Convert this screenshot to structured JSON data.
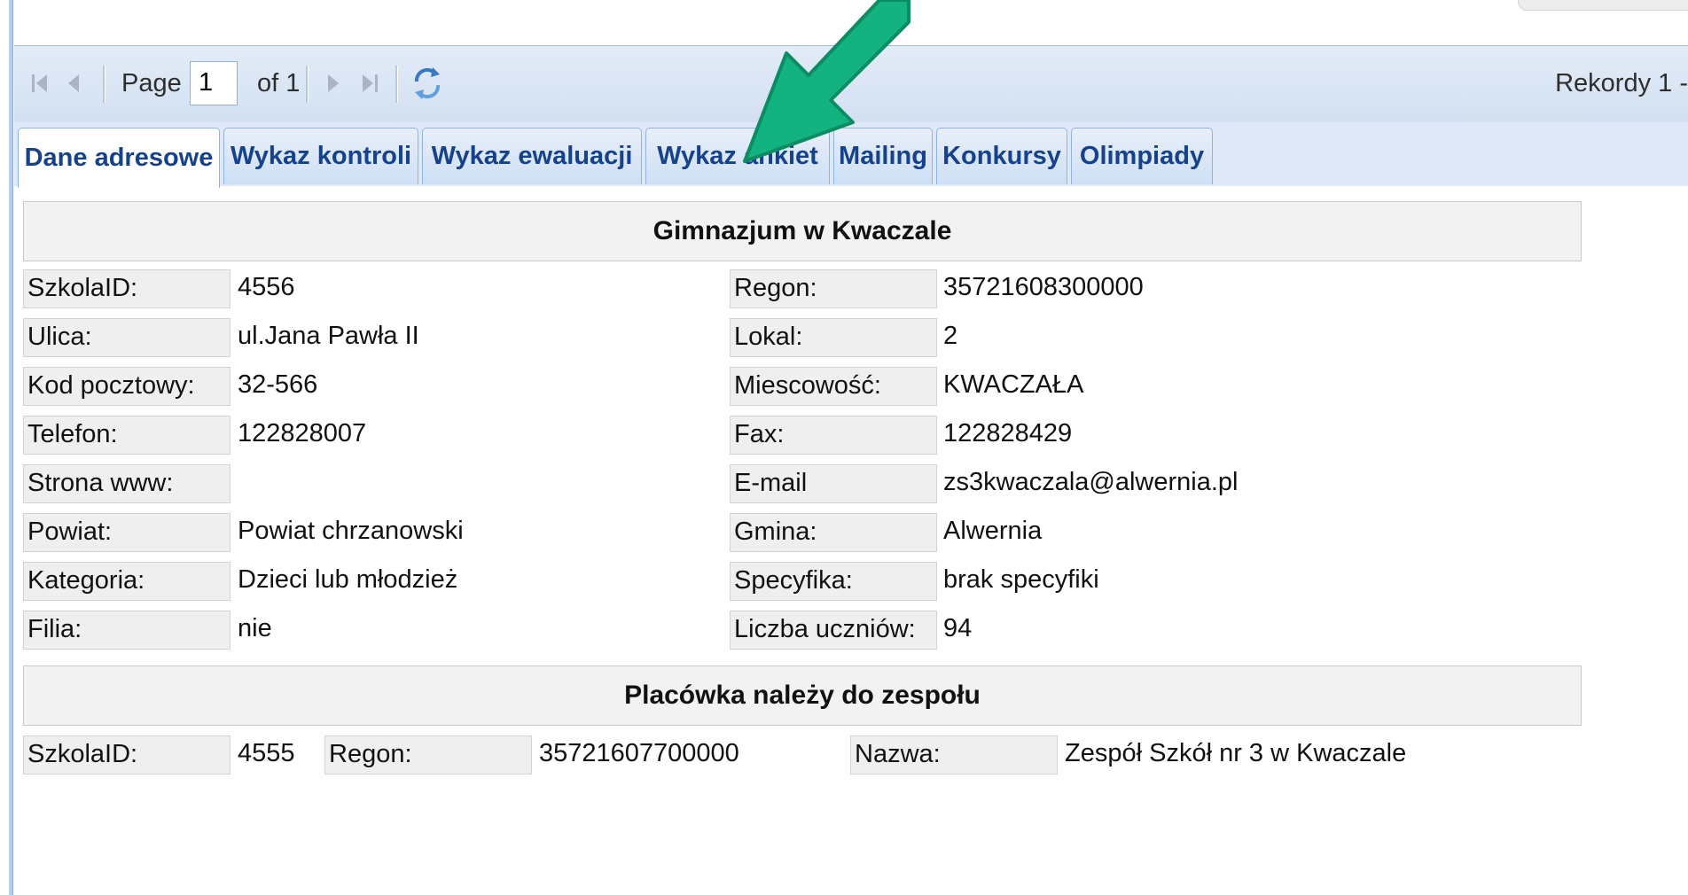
{
  "toolbar": {
    "page_label": "Page",
    "page_value": "1",
    "of_label": "of 1",
    "records_text": "Rekordy 1 -"
  },
  "tabs": [
    {
      "label": "Dane adresowe",
      "active": true
    },
    {
      "label": "Wykaz kontroli",
      "active": false
    },
    {
      "label": "Wykaz ewaluacji",
      "active": false
    },
    {
      "label": "Wykaz ankiet",
      "active": false
    },
    {
      "label": "Mailing",
      "active": false
    },
    {
      "label": "Konkursy",
      "active": false
    },
    {
      "label": "Olimpiady",
      "active": false
    }
  ],
  "school": {
    "title": "Gimnazjum w Kwaczale",
    "left_fields": [
      {
        "label": "SzkolaID:",
        "value": "4556"
      },
      {
        "label": "Ulica:",
        "value": "ul.Jana Pawła II"
      },
      {
        "label": "Kod pocztowy:",
        "value": "32-566"
      },
      {
        "label": "Telefon:",
        "value": "122828007"
      },
      {
        "label": "Strona www:",
        "value": ""
      },
      {
        "label": "Powiat:",
        "value": "Powiat chrzanowski"
      },
      {
        "label": "Kategoria:",
        "value": "Dzieci lub młodzież"
      },
      {
        "label": "Filia:",
        "value": "nie"
      }
    ],
    "right_fields": [
      {
        "label": "Regon:",
        "value": "35721608300000"
      },
      {
        "label": "Lokal:",
        "value": "2"
      },
      {
        "label": "Miescowość:",
        "value": "KWACZAŁA"
      },
      {
        "label": "Fax:",
        "value": "122828429"
      },
      {
        "label": "E-mail",
        "value": "zs3kwaczala@alwernia.pl"
      },
      {
        "label": "Gmina:",
        "value": "Alwernia"
      },
      {
        "label": "Specyfika:",
        "value": "brak specyfiki"
      },
      {
        "label": "Liczba uczniów:",
        "value": "94"
      }
    ]
  },
  "parent": {
    "title": "Placówka należy do zespołu",
    "szkolaid_label": "SzkolaID:",
    "szkolaid_value": "4555",
    "regon_label": "Regon:",
    "regon_value": "35721607700000",
    "nazwa_label": "Nazwa:",
    "nazwa_value": "Zespół Szkół nr 3 w Kwaczale"
  },
  "colors": {
    "tab_text": "#15428b",
    "annotation_arrow": "#13b380"
  },
  "icons": [
    "first-page-icon",
    "prev-page-icon",
    "next-page-icon",
    "last-page-icon",
    "refresh-icon"
  ]
}
